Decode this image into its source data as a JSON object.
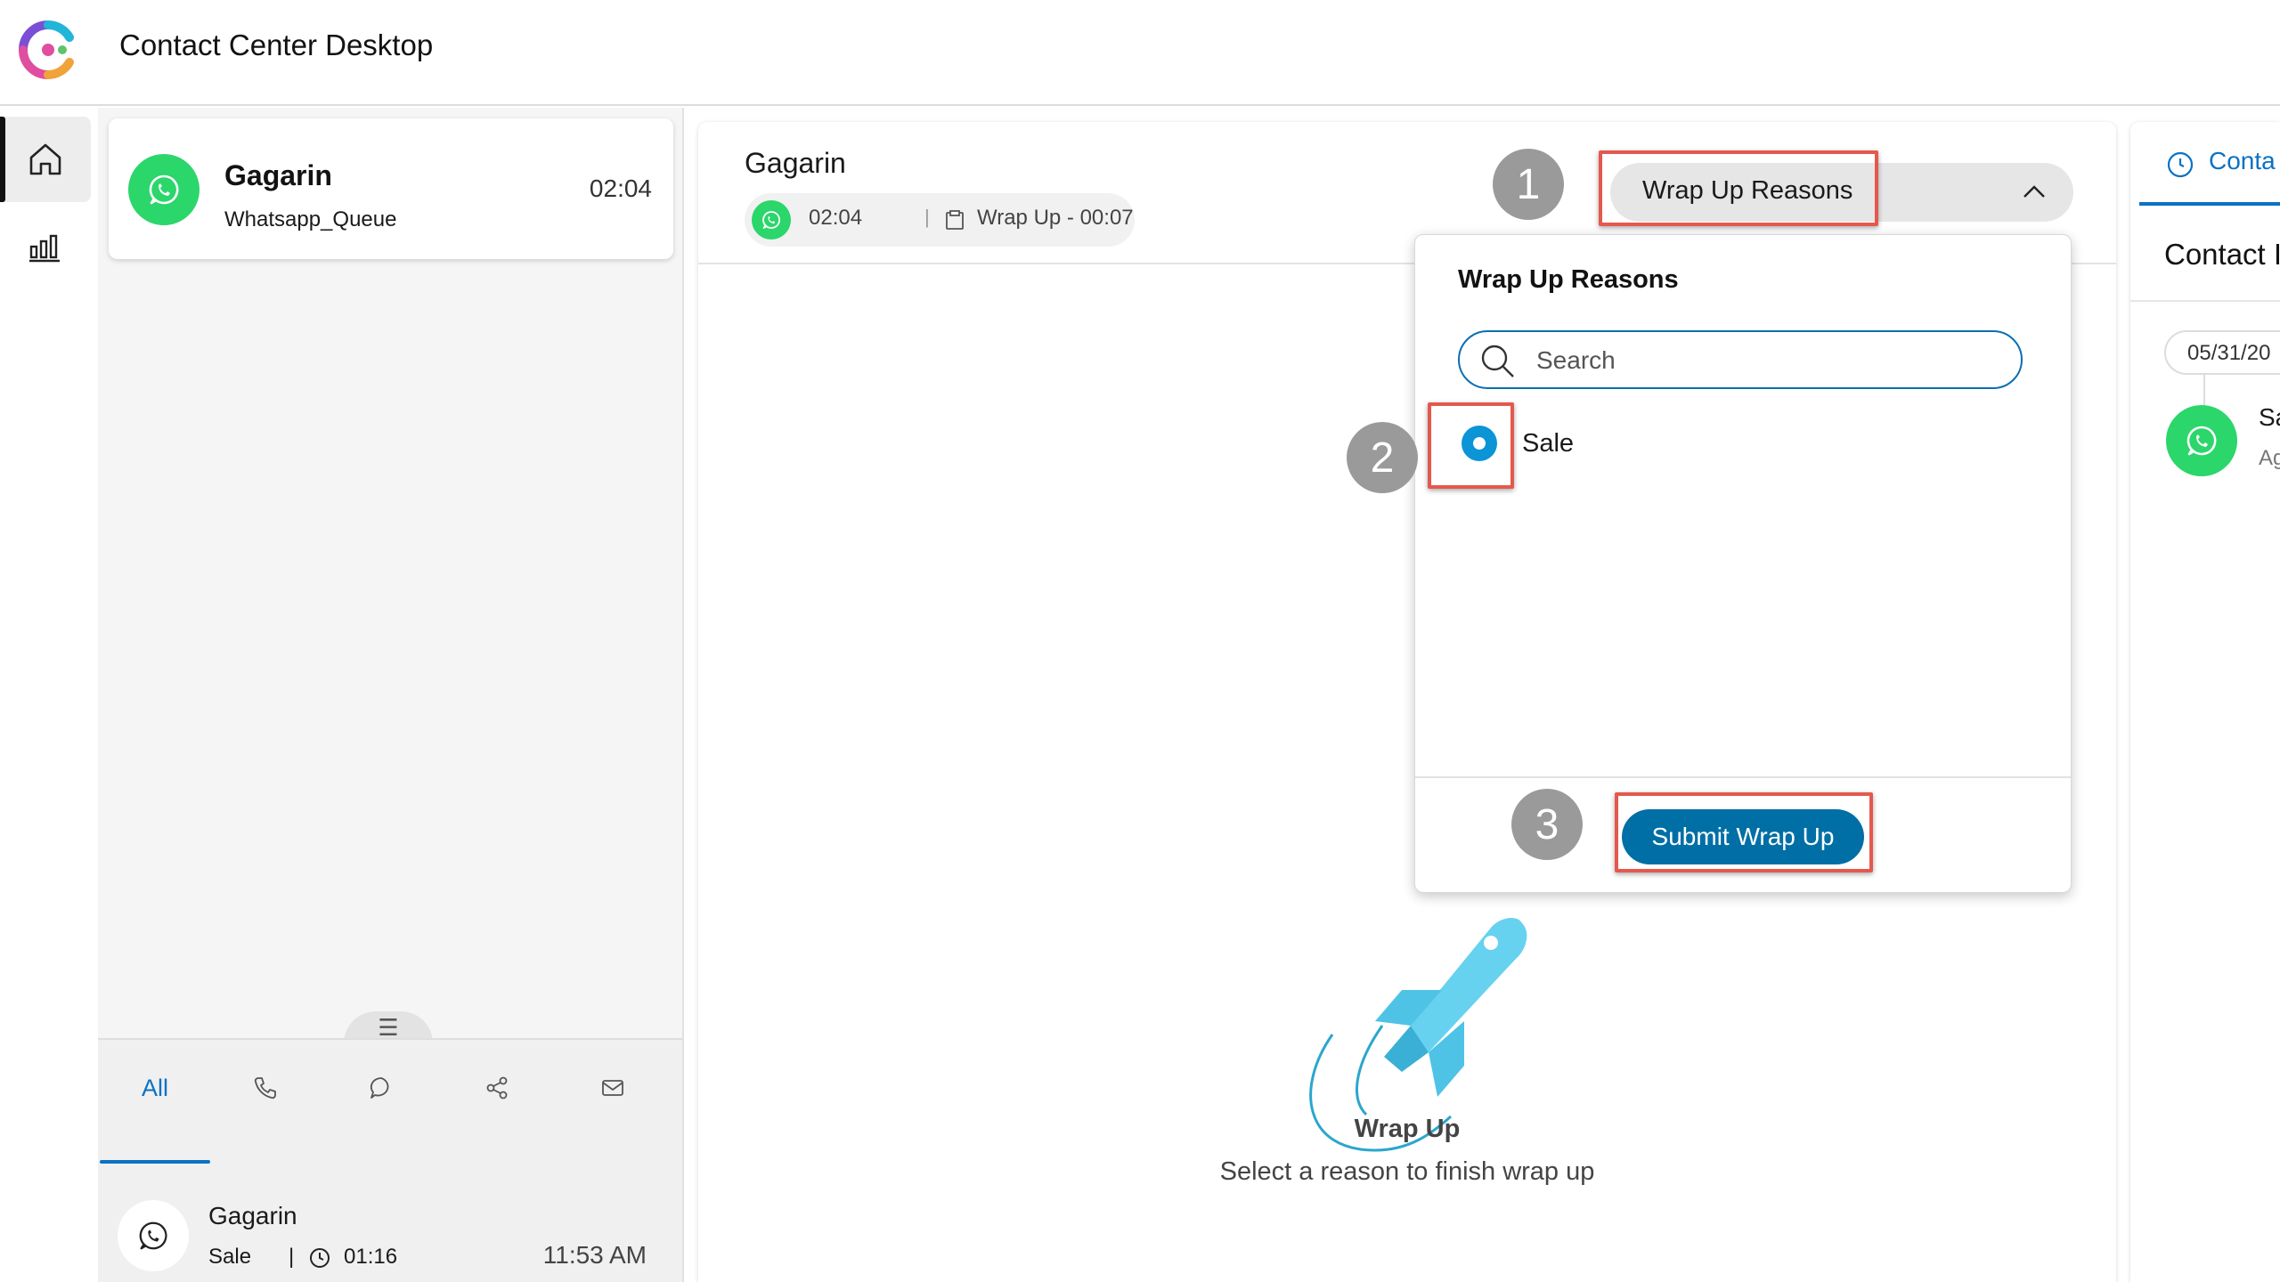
{
  "app": {
    "title": "Contact Center Desktop"
  },
  "rail": {
    "items": [
      {
        "icon": "home-icon",
        "active": true
      },
      {
        "icon": "analytics-icon",
        "active": false
      }
    ]
  },
  "task": {
    "name": "Gagarin",
    "queue": "Whatsapp_Queue",
    "timer": "02:04",
    "channel_icon": "whatsapp-icon"
  },
  "history": {
    "tabs": [
      {
        "label": "All",
        "active": true
      },
      {
        "icon": "phone-icon"
      },
      {
        "icon": "chat-icon"
      },
      {
        "icon": "share-icon"
      },
      {
        "icon": "mail-icon"
      }
    ],
    "item": {
      "name": "Gagarin",
      "reason": "Sale",
      "separator": "|",
      "duration": "01:16",
      "time": "11:53 AM"
    }
  },
  "interaction": {
    "name": "Gagarin",
    "timer": "02:04",
    "separator": "|",
    "state": "Wrap Up  -  00:07",
    "wrap_select_label": "Wrap Up Reasons"
  },
  "dropdown": {
    "title": "Wrap Up Reasons",
    "search_placeholder": "Search",
    "options": [
      {
        "label": "Sale",
        "selected": true
      }
    ],
    "submit_label": "Submit Wrap Up"
  },
  "empty_state": {
    "title": "Wrap Up",
    "subtitle": "Select a reason to finish wrap up"
  },
  "steps": [
    "1",
    "2",
    "3"
  ],
  "aux": {
    "tab_label": "Conta",
    "heading": "Contact I",
    "date": "05/31/20",
    "row_name": "Sa",
    "row_sub": "Ag"
  },
  "colors": {
    "accent": "#0a72c4",
    "whatsapp": "#2bd66b",
    "submit": "#006fa6",
    "radio": "#0b94d6",
    "highlight": "#e5584d",
    "step": "#9a9a9a"
  }
}
